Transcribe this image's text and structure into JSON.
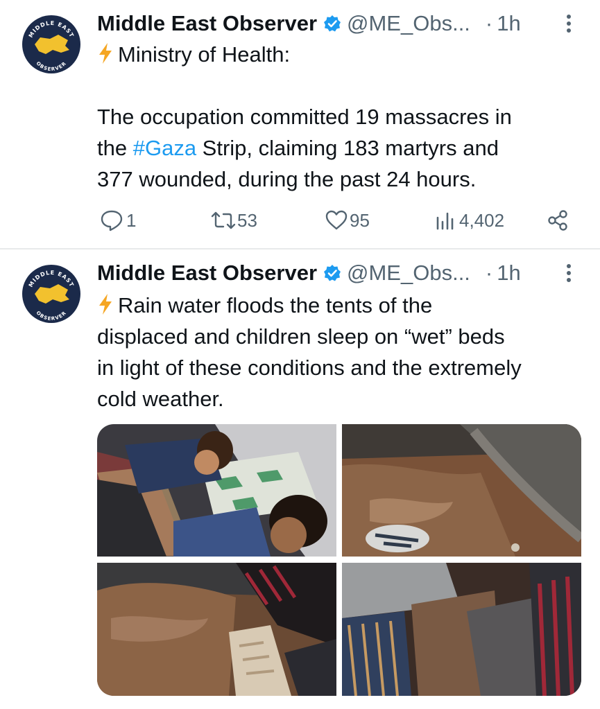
{
  "tweets": [
    {
      "author_name": "Middle East Observer",
      "handle": "@ME_Obs...",
      "dot": "·",
      "time": "1h",
      "text_lines": [
        "Ministry of Health:",
        "",
        "The occupation committed 19 massacres in",
        "the ",
        "#Gaza",
        " Strip, claiming 183 martyrs and",
        "377 wounded, during the past 24 hours."
      ],
      "replies": "1",
      "retweets": "53",
      "likes": "95",
      "views": "4,402"
    },
    {
      "author_name": "Middle East Observer",
      "handle": "@ME_Obs...",
      "dot": "·",
      "time": "1h",
      "text_lines": [
        "Rain water floods the tents of the",
        "displaced and children sleep on “wet” beds",
        "in light of these conditions and the extremely",
        "cold weather."
      ]
    }
  ],
  "avatar": {
    "logo_top": "MIDDLE EAST",
    "logo_bottom": "OBSERVER"
  },
  "icons": [
    "verified-badge-icon",
    "more-vertical-icon",
    "lightning-bolt-icon",
    "reply-icon",
    "retweet-icon",
    "like-heart-icon",
    "views-chart-icon",
    "share-icon"
  ],
  "colors": {
    "accent": "#1d9bf0",
    "muted": "#536471",
    "text": "#0f1419",
    "bolt": "#f5a623",
    "logo_navy": "#1b2a4a",
    "logo_gold": "#f2c12e"
  }
}
